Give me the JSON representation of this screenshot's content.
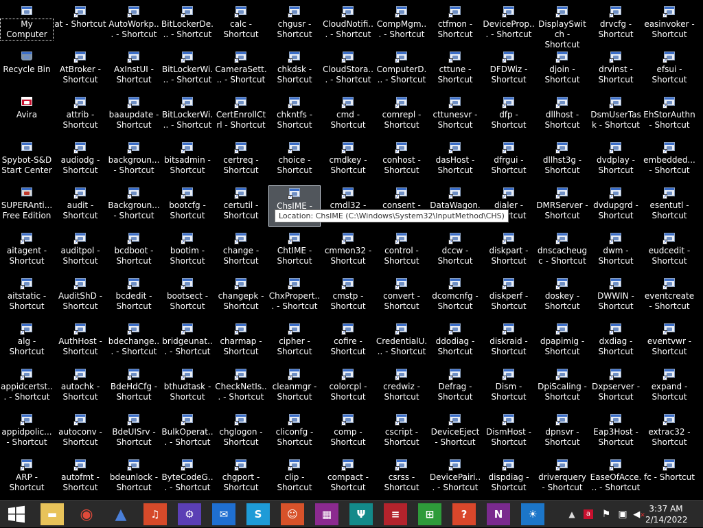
{
  "desktop": {
    "columns": [
      [
        [
          "My Computer",
          "pc"
        ],
        [
          "Recycle Bin",
          "recycle"
        ],
        [
          "Avira",
          "red"
        ],
        [
          "Spybot-S&D Start Center",
          "app"
        ],
        [
          "SUPERAnti... Free Edition",
          "shield"
        ],
        [
          "aitagent - Shortcut",
          "sc"
        ],
        [
          "aitstatic - Shortcut",
          "sc"
        ],
        [
          "alg - Shortcut",
          "sc"
        ],
        [
          "appidcertst... - Shortcut",
          "sc"
        ],
        [
          "appidpolic... - Shortcut",
          "sc"
        ],
        [
          "ARP - Shortcut",
          "sc"
        ]
      ],
      [
        [
          "at - Shortcut",
          "sc"
        ],
        [
          "AtBroker - Shortcut",
          "sc"
        ],
        [
          "attrib - Shortcut",
          "sc"
        ],
        [
          "audiodg - Shortcut",
          "sc"
        ],
        [
          "audit - Shortcut",
          "sc"
        ],
        [
          "auditpol - Shortcut",
          "sc"
        ],
        [
          "AuditShD - Shortcut",
          "sc"
        ],
        [
          "AuthHost - Shortcut",
          "sc"
        ],
        [
          "autochk - Shortcut",
          "sc"
        ],
        [
          "autoconv - Shortcut",
          "sc"
        ],
        [
          "autofmt - Shortcut",
          "sc"
        ]
      ],
      [
        [
          "AutoWorkp... - Shortcut",
          "sc"
        ],
        [
          "AxInstUI - Shortcut",
          "sc"
        ],
        [
          "baaupdate - Shortcut",
          "sc"
        ],
        [
          "backgroun... - Shortcut",
          "sc"
        ],
        [
          "Backgroun... - Shortcut",
          "sc"
        ],
        [
          "bcdboot - Shortcut",
          "sc"
        ],
        [
          "bcdedit - Shortcut",
          "sc"
        ],
        [
          "bdechange... - Shortcut",
          "sc"
        ],
        [
          "BdeHdCfg - Shortcut",
          "sc"
        ],
        [
          "BdeUISrv - Shortcut",
          "sc"
        ],
        [
          "bdeunlock - Shortcut",
          "sc"
        ]
      ],
      [
        [
          "BitLockerDe... - Shortcut",
          "sc"
        ],
        [
          "BitLockerWi... - Shortcut",
          "sc"
        ],
        [
          "BitLockerWi... - Shortcut",
          "sc"
        ],
        [
          "bitsadmin - Shortcut",
          "sc"
        ],
        [
          "bootcfg - Shortcut",
          "sc"
        ],
        [
          "bootim - Shortcut",
          "sc"
        ],
        [
          "bootsect - Shortcut",
          "sc"
        ],
        [
          "bridgeunat... - Shortcut",
          "sc"
        ],
        [
          "bthudtask - Shortcut",
          "sc"
        ],
        [
          "BulkOperat... - Shortcut",
          "sc"
        ],
        [
          "ByteCodeG... - Shortcut",
          "sc"
        ]
      ],
      [
        [
          "calc - Shortcut",
          "sc"
        ],
        [
          "CameraSett... - Shortcut",
          "sc"
        ],
        [
          "CertEnrollCtrl - Shortcut",
          "sc"
        ],
        [
          "certreq - Shortcut",
          "sc"
        ],
        [
          "certutil - Shortcut",
          "sc"
        ],
        [
          "change - Shortcut",
          "sc"
        ],
        [
          "changepk - Shortcut",
          "sc"
        ],
        [
          "charmap - Shortcut",
          "sc"
        ],
        [
          "CheckNetIs... - Shortcut",
          "sc"
        ],
        [
          "chglogon - Shortcut",
          "sc"
        ],
        [
          "chgport - Shortcut",
          "sc"
        ]
      ],
      [
        [
          "chgusr - Shortcut",
          "sc"
        ],
        [
          "chkdsk - Shortcut",
          "sc"
        ],
        [
          "chkntfs - Shortcut",
          "sc"
        ],
        [
          "choice - Shortcut",
          "sc"
        ],
        [
          "ChsIME - Shortcut",
          "sc"
        ],
        [
          "ChtIME - Shortcut",
          "sc"
        ],
        [
          "ChxPropert... - Shortcut",
          "sc"
        ],
        [
          "cipher - Shortcut",
          "sc"
        ],
        [
          "cleanmgr - Shortcut",
          "sc"
        ],
        [
          "cliconfg - Shortcut",
          "sc"
        ],
        [
          "clip - Shortcut",
          "sc"
        ]
      ],
      [
        [
          "CloudNotifi... - Shortcut",
          "sc"
        ],
        [
          "CloudStora... - Shortcut",
          "sc"
        ],
        [
          "cmd - Shortcut",
          "sc"
        ],
        [
          "cmdkey - Shortcut",
          "sc"
        ],
        [
          "cmdl32 - Shortcut",
          "sc"
        ],
        [
          "cmmon32 - Shortcut",
          "sc"
        ],
        [
          "cmstp - Shortcut",
          "sc"
        ],
        [
          "cofire - Shortcut",
          "sc"
        ],
        [
          "colorcpl - Shortcut",
          "sc"
        ],
        [
          "comp - Shortcut",
          "sc"
        ],
        [
          "compact - Shortcut",
          "sc"
        ]
      ],
      [
        [
          "CompMgm... - Shortcut",
          "sc"
        ],
        [
          "ComputerD... - Shortcut",
          "sc"
        ],
        [
          "comrepl - Shortcut",
          "sc"
        ],
        [
          "conhost - Shortcut",
          "sc"
        ],
        [
          "consent - Shortcut",
          "sc"
        ],
        [
          "control - Shortcut",
          "sc"
        ],
        [
          "convert - Shortcut",
          "sc"
        ],
        [
          "CredentialU... - Shortcut",
          "sc"
        ],
        [
          "credwiz - Shortcut",
          "sc"
        ],
        [
          "cscript - Shortcut",
          "sc"
        ],
        [
          "csrss - Shortcut",
          "sc"
        ]
      ],
      [
        [
          "ctfmon - Shortcut",
          "sc"
        ],
        [
          "cttune - Shortcut",
          "sc"
        ],
        [
          "cttunesvr - Shortcut",
          "sc"
        ],
        [
          "dasHost - Shortcut",
          "sc"
        ],
        [
          "DataWagon... - Shortcut",
          "sc"
        ],
        [
          "dccw - Shortcut",
          "sc"
        ],
        [
          "dcomcnfg - Shortcut",
          "sc"
        ],
        [
          "ddodiag - Shortcut",
          "sc"
        ],
        [
          "Defrag - Shortcut",
          "sc"
        ],
        [
          "DeviceEject - Shortcut",
          "sc"
        ],
        [
          "DevicePairi... - Shortcut",
          "sc"
        ]
      ],
      [
        [
          "DeviceProp... - Shortcut",
          "sc"
        ],
        [
          "DFDWiz - Shortcut",
          "sc"
        ],
        [
          "dfp - Shortcut",
          "sc"
        ],
        [
          "dfrgui - Shortcut",
          "sc"
        ],
        [
          "dialer - Shortcut",
          "sc"
        ],
        [
          "diskpart - Shortcut",
          "sc"
        ],
        [
          "diskperf - Shortcut",
          "sc"
        ],
        [
          "diskraid - Shortcut",
          "sc"
        ],
        [
          "Dism - Shortcut",
          "sc"
        ],
        [
          "DismHost - Shortcut",
          "sc"
        ],
        [
          "dispdiag - Shortcut",
          "sc"
        ]
      ],
      [
        [
          "DisplaySwitch - Shortcut",
          "sc"
        ],
        [
          "djoin - Shortcut",
          "sc"
        ],
        [
          "dllhost - Shortcut",
          "sc"
        ],
        [
          "dllhst3g - Shortcut",
          "sc"
        ],
        [
          "DMRServer - Shortcut",
          "sc"
        ],
        [
          "dnscacheugc - Shortcut",
          "sc"
        ],
        [
          "doskey - Shortcut",
          "sc"
        ],
        [
          "dpapimig - Shortcut",
          "sc"
        ],
        [
          "DpiScaling - Shortcut",
          "sc"
        ],
        [
          "dpnsvr - Shortcut",
          "sc"
        ],
        [
          "driverquery - Shortcut",
          "sc"
        ]
      ],
      [
        [
          "drvcfg - Shortcut",
          "sc"
        ],
        [
          "drvinst - Shortcut",
          "sc"
        ],
        [
          "DsmUserTask - Shortcut",
          "sc"
        ],
        [
          "dvdplay - Shortcut",
          "sc"
        ],
        [
          "dvdupgrd - Shortcut",
          "sc"
        ],
        [
          "dwm - Shortcut",
          "sc"
        ],
        [
          "DWWIN - Shortcut",
          "sc"
        ],
        [
          "dxdiag - Shortcut",
          "sc"
        ],
        [
          "Dxpserver - Shortcut",
          "sc"
        ],
        [
          "Eap3Host - Shortcut",
          "sc"
        ],
        [
          "EaseOfAcce... - Shortcut",
          "sc"
        ]
      ],
      [
        [
          "easinvoker - Shortcut",
          "sc"
        ],
        [
          "efsui - Shortcut",
          "sc"
        ],
        [
          "EhStorAuthn - Shortcut",
          "sc"
        ],
        [
          "embedded... - Shortcut",
          "sc"
        ],
        [
          "esentutl - Shortcut",
          "sc"
        ],
        [
          "eudcedit - Shortcut",
          "sc"
        ],
        [
          "eventcreate - Shortcut",
          "sc"
        ],
        [
          "eventvwr - Shortcut",
          "sc"
        ],
        [
          "expand - Shortcut",
          "sc"
        ],
        [
          "extrac32 - Shortcut",
          "sc"
        ],
        [
          "fc - Shortcut",
          "sc"
        ]
      ]
    ],
    "selected_col": 5,
    "selected_row": 4,
    "tooltip": "Location: ChsIME (C:\\Windows\\System32\\InputMethod\\CHS)"
  },
  "taskbar": {
    "pinned": [
      {
        "name": "file-explorer",
        "glyph": "▬",
        "bg": "#e8c35a"
      },
      {
        "name": "chrome",
        "glyph": "◉",
        "bg": "#2a2a2a",
        "fg": "#e04a3a"
      },
      {
        "name": "shape-app",
        "glyph": "▲",
        "bg": "#2a2a2a",
        "fg": "#4a7fd8"
      },
      {
        "name": "music",
        "glyph": "♫",
        "bg": "#d64a2a"
      },
      {
        "name": "settings",
        "glyph": "⚙",
        "bg": "#5b3fb5"
      },
      {
        "name": "mail",
        "glyph": "✉",
        "bg": "#1f6fd1"
      },
      {
        "name": "skype",
        "glyph": "S",
        "bg": "#1e9bd7"
      },
      {
        "name": "people",
        "glyph": "☺",
        "bg": "#d7522a"
      },
      {
        "name": "maps",
        "glyph": "▦",
        "bg": "#8b2a8f"
      },
      {
        "name": "food",
        "glyph": "Ψ",
        "bg": "#138a8a"
      },
      {
        "name": "news",
        "glyph": "≡",
        "bg": "#b3232c"
      },
      {
        "name": "store",
        "glyph": "⊞",
        "bg": "#2e9b3a"
      },
      {
        "name": "help",
        "glyph": "?",
        "bg": "#d9472b"
      },
      {
        "name": "onenote",
        "glyph": "N",
        "bg": "#7a2a8e"
      },
      {
        "name": "weather",
        "glyph": "☀",
        "bg": "#1c76c9"
      }
    ],
    "clock": {
      "time": "3:37 AM",
      "date": "2/14/2022"
    }
  }
}
